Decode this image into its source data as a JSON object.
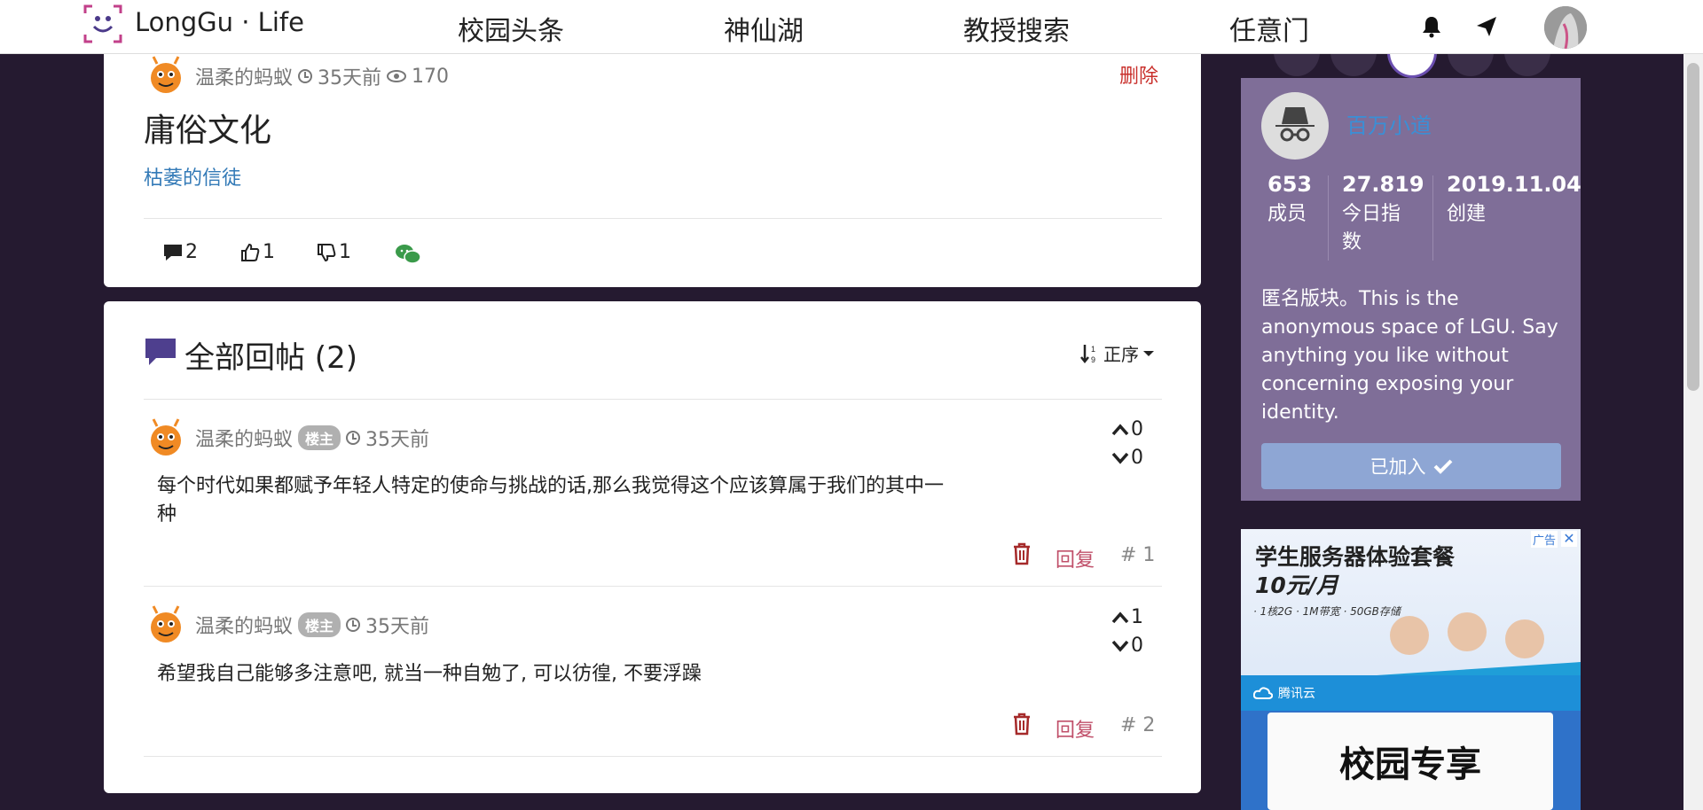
{
  "brand": {
    "name": "LongGu · Life"
  },
  "nav": {
    "links": [
      "校园头条",
      "神仙湖",
      "教授搜索",
      "任意门"
    ]
  },
  "post": {
    "author": "温柔的蚂蚁",
    "time": "35天前",
    "views": "170",
    "delete_label": "删除",
    "title": "庸俗文化",
    "tag": "枯萎的信徒",
    "comments": "2",
    "likes": "1",
    "dislikes": "1"
  },
  "replies_section": {
    "title": "全部回帖 (2)",
    "sort_label": "正序",
    "reply_label": "回复",
    "items": [
      {
        "author": "温柔的蚂蚁",
        "badge": "楼主",
        "time": "35天前",
        "upvotes": "0",
        "downvotes": "0",
        "text_line1": "每个时代如果都赋予年轻人特定的使命与挑战的话,那么我觉得这个应该算属于我们的其中一",
        "text_line2": "种",
        "floor": "# 1"
      },
      {
        "author": "温柔的蚂蚁",
        "badge": "楼主",
        "time": "35天前",
        "upvotes": "1",
        "downvotes": "0",
        "text_line1": "希望我自己能够多注意吧, 就当一种自勉了, 可以彷徨, 不要浮躁",
        "text_line2": "",
        "floor": "# 2"
      }
    ]
  },
  "board": {
    "name": "百万小道",
    "stats": [
      {
        "value": "653",
        "label_line1": "成员",
        "label_line2": ""
      },
      {
        "value": "27.819",
        "label_line1": "今日指",
        "label_line2": "数"
      },
      {
        "value": "2019.11.04",
        "label_line1": "创建",
        "label_line2": ""
      }
    ],
    "description": [
      "匿名版块。This is the",
      "anonymous space of LGU. Say",
      "anything you like without",
      "concerning exposing your",
      "identity."
    ],
    "joined_label": "已加入"
  },
  "ad": {
    "tag": "广告",
    "headline1": "学生服务器体验套餐",
    "headline2": "10元/月",
    "specs": "· 1核2G  · 1M带宽  · 50GB存储",
    "provider": "腾讯云",
    "banner": "校园专享"
  },
  "colors": {
    "background": "#251a30",
    "sidebar": "#7f6e98",
    "accent_link": "#337ab7",
    "delete": "#c9302c",
    "reply": "#c0506a",
    "chat_icon": "#4e3f8e"
  }
}
